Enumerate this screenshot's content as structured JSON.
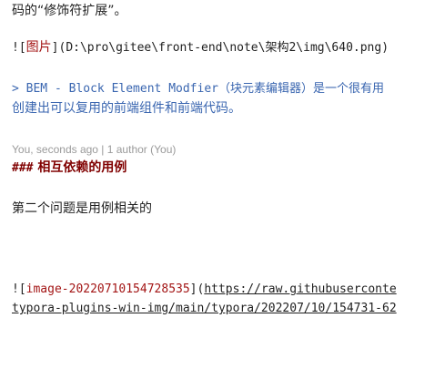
{
  "editor": {
    "line1_text": "码的“修饰符扩展”。",
    "image_link_1": {
      "open_bracket": "![",
      "alt": "图片",
      "mid": "](",
      "path": "D:\\pro\\gitee\\front-end\\note\\架构2\\img\\640.png",
      "close": ")"
    },
    "quote": {
      "marker": ">",
      "line1": "BEM - Block Element Modfier（块元素编辑器）是一个很有用",
      "line2": "创建出可以复用的前端组件和前端代码。"
    },
    "blame": "You, seconds ago | 1 author (You)",
    "heading": {
      "marker": "###",
      "text": "相互依赖的用例"
    },
    "paragraph": "第二个问题是用例相关的",
    "image_link_2": {
      "open_bracket": "![",
      "alt": "image-20220710154728535",
      "mid": "](",
      "url_line1": "https://raw.githubuserconte",
      "url_line2": "typora-plugins-win-img/main/typora/202207/10/154731-62"
    }
  }
}
